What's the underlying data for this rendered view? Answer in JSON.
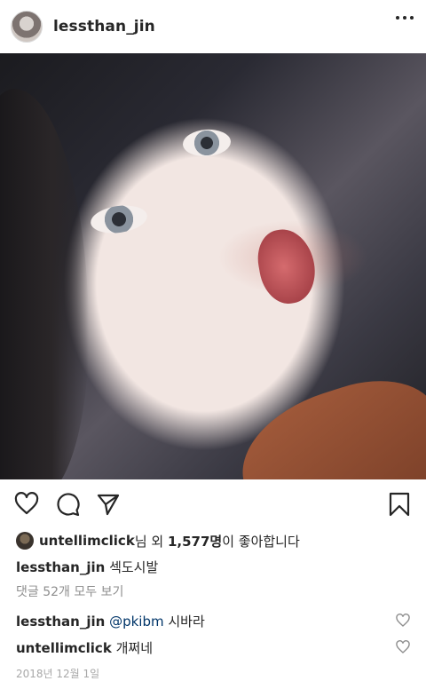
{
  "header": {
    "username": "lessthan_jin"
  },
  "likes": {
    "user": "untellimclick",
    "mid": "님 외 ",
    "count": "1,577명",
    "suffix": "이 좋아합니다"
  },
  "caption": {
    "username": "lessthan_jin",
    "text": "섹도시발"
  },
  "view_comments": "댓글 52개 모두 보기",
  "comments": [
    {
      "username": "lessthan_jin",
      "mention": "@pkibm",
      "text": " 시바라"
    },
    {
      "username": "untellimclick",
      "mention": "",
      "text": "개쩌네"
    }
  ],
  "timestamp": "2018년 12월 1일",
  "icons": {
    "like": "heart-icon",
    "comment": "comment-icon",
    "share": "send-icon",
    "save": "bookmark-icon",
    "more": "more-icon"
  }
}
